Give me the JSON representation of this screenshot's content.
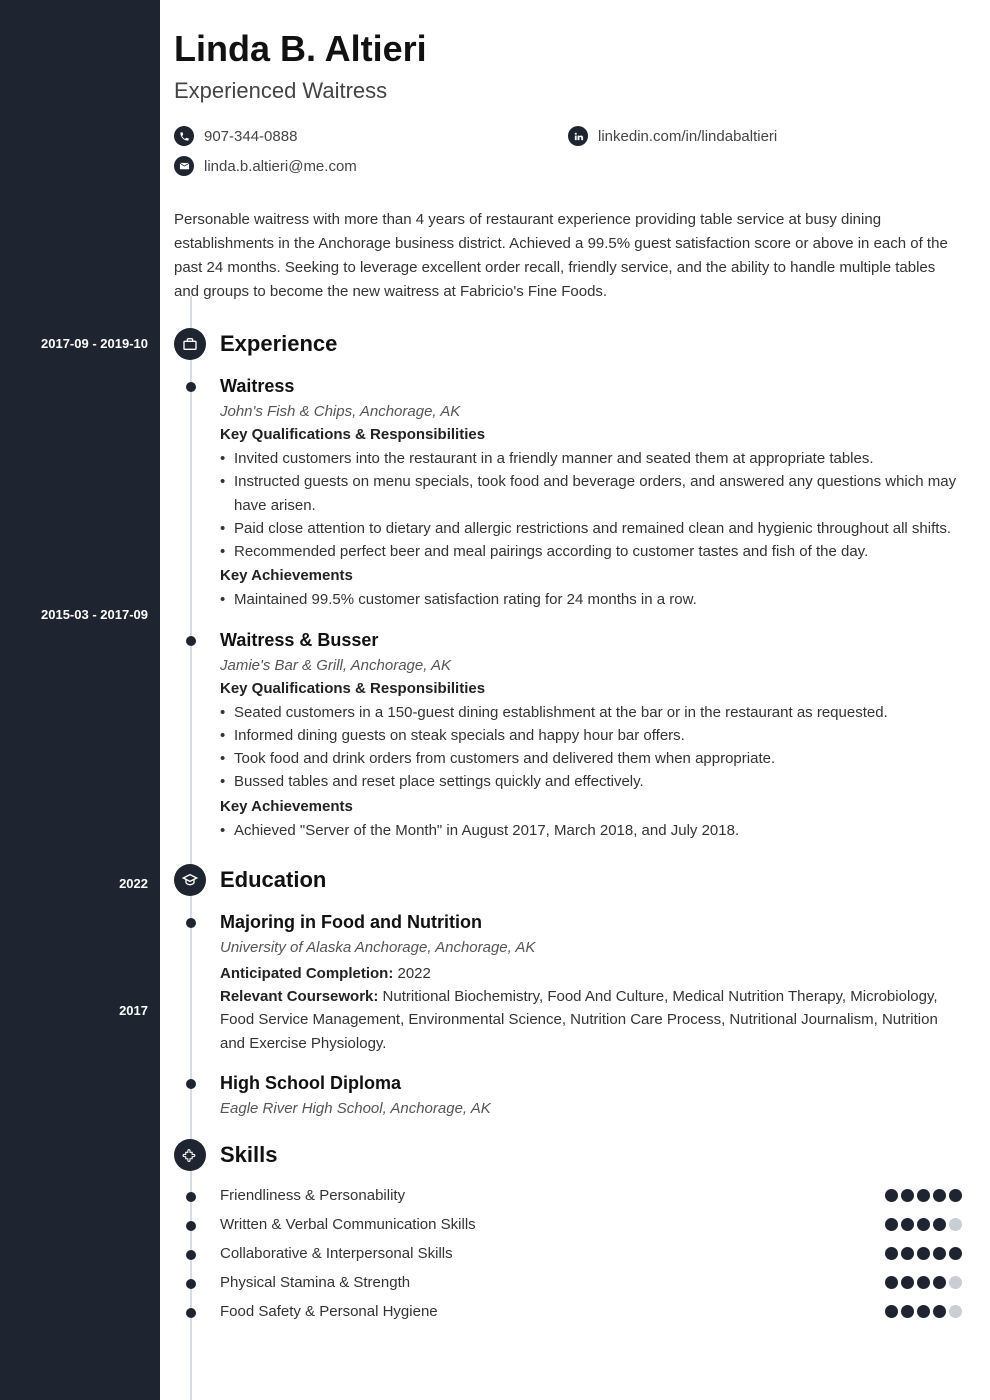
{
  "header": {
    "name": "Linda B. Altieri",
    "title": "Experienced Waitress"
  },
  "contacts": {
    "phone": "907-344-0888",
    "linkedin": "linkedin.com/in/lindabaltieri",
    "email": "linda.b.altieri@me.com"
  },
  "summary": "Personable waitress with more than 4 years of restaurant experience providing table service at busy dining establishments in the Anchorage business district. Achieved a 99.5% guest satisfaction score or above in each of the past 24 months. Seeking to leverage excellent order recall, friendly service, and the ability to handle multiple tables and groups to become the new waitress at Fabricio's Fine Foods.",
  "sections": {
    "experience": {
      "title": "Experience",
      "entries": [
        {
          "date": "2017-09 - 2019-10",
          "title": "Waitress",
          "sub": "John's Fish & Chips, Anchorage, AK",
          "qual_label": "Key Qualifications & Responsibilities",
          "quals": [
            "Invited customers into the restaurant in a friendly manner and seated them at appropriate tables.",
            "Instructed guests on menu specials, took food and beverage orders, and answered any questions which may have arisen.",
            "Paid close attention to dietary and allergic restrictions and remained clean and hygienic throughout all shifts.",
            "Recommended perfect beer and meal pairings according to customer tastes and fish of the day."
          ],
          "ach_label": "Key Achievements",
          "achs": [
            "Maintained 99.5% customer satisfaction rating for 24 months in a row."
          ]
        },
        {
          "date": "2015-03 - 2017-09",
          "title": "Waitress & Busser",
          "sub": "Jamie's Bar & Grill, Anchorage, AK",
          "qual_label": "Key Qualifications & Responsibilities",
          "quals": [
            "Seated customers in a 150-guest dining establishment at the bar or in the restaurant as requested.",
            "Informed dining guests on steak specials and happy hour bar offers.",
            "Took food and drink orders from customers and delivered them when appropriate.",
            "Bussed tables and reset place settings quickly and effectively."
          ],
          "ach_label": "Key Achievements",
          "achs": [
            "Achieved \"Server of the Month\" in August 2017, March 2018, and July 2018."
          ]
        }
      ]
    },
    "education": {
      "title": "Education",
      "entries": [
        {
          "date": "2022",
          "title": "Majoring in Food and Nutrition",
          "sub": "University of Alaska Anchorage, Anchorage, AK",
          "ant_label": "Anticipated Completion:",
          "ant_value": " 2022",
          "course_label": "Relevant Coursework:",
          "course_value": " Nutritional Biochemistry, Food And Culture, Medical Nutrition Therapy, Microbiology, Food Service Management, Environmental Science, Nutrition Care Process, Nutritional Journalism, Nutrition and Exercise Physiology."
        },
        {
          "date": "2017",
          "title": "High School Diploma",
          "sub": "Eagle River High School, Anchorage, AK"
        }
      ]
    },
    "skills": {
      "title": "Skills",
      "items": [
        {
          "name": "Friendliness & Personability",
          "rating": 5
        },
        {
          "name": "Written & Verbal Communication Skills",
          "rating": 4
        },
        {
          "name": "Collaborative & Interpersonal Skills",
          "rating": 5
        },
        {
          "name": "Physical Stamina & Strength",
          "rating": 4
        },
        {
          "name": "Food Safety & Personal Hygiene",
          "rating": 4
        }
      ]
    }
  }
}
